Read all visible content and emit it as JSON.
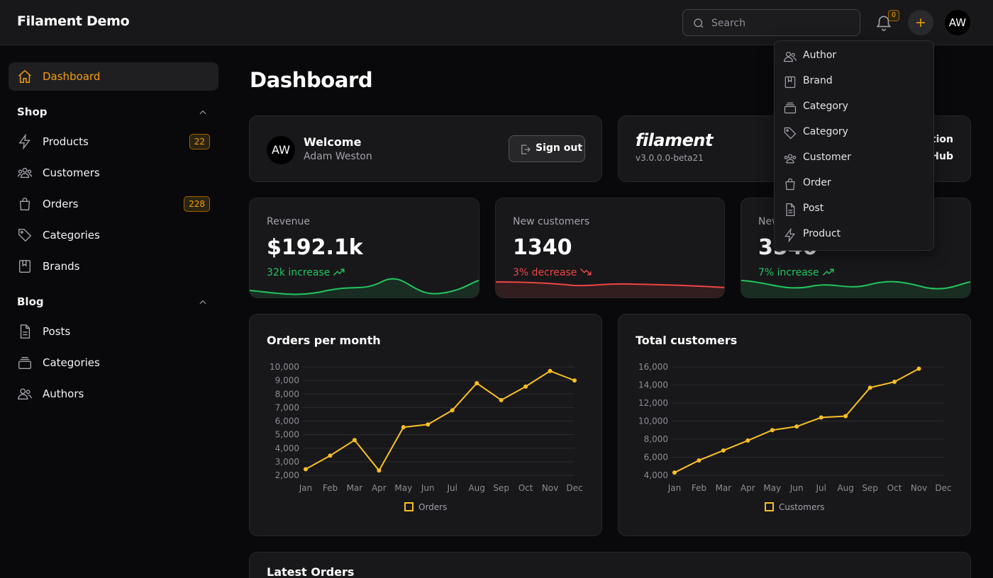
{
  "app": {
    "brand": "Filament Demo"
  },
  "topbar": {
    "search_placeholder": "Search",
    "notifications_count": "0",
    "user_initials": "AW"
  },
  "sidebar": {
    "dashboard": {
      "label": "Dashboard",
      "icon": "home-icon"
    },
    "groups": [
      {
        "title": "Shop",
        "items": [
          {
            "label": "Products",
            "icon": "bolt-icon",
            "badge": "22"
          },
          {
            "label": "Customers",
            "icon": "users-group-icon",
            "badge": ""
          },
          {
            "label": "Orders",
            "icon": "shopping-bag-icon",
            "badge": "228"
          },
          {
            "label": "Categories",
            "icon": "tag-icon",
            "badge": ""
          },
          {
            "label": "Brands",
            "icon": "book-icon",
            "badge": ""
          }
        ]
      },
      {
        "title": "Blog",
        "items": [
          {
            "label": "Posts",
            "icon": "document-icon"
          },
          {
            "label": "Categories",
            "icon": "rectangle-stack-icon"
          },
          {
            "label": "Authors",
            "icon": "users-icon"
          }
        ]
      }
    ]
  },
  "main": {
    "title": "Dashboard",
    "welcome": {
      "initials": "AW",
      "title": "Welcome",
      "name": "Adam Weston",
      "signout_label": "Sign out"
    },
    "filament": {
      "logo": "filament",
      "version": "v3.0.0.0-beta21",
      "link1": "tion",
      "link2": "Hub"
    },
    "stats": [
      {
        "label": "Revenue",
        "value": "$192.1k",
        "description": "32k increase",
        "trend": "up",
        "color": "#22c55e"
      },
      {
        "label": "New customers",
        "value": "1340",
        "description": "3% decrease",
        "trend": "down",
        "color": "#ef4444"
      },
      {
        "label": "New orders",
        "value": "3540",
        "description": "7% increase",
        "trend": "up",
        "color": "#22c55e"
      }
    ],
    "latest_orders_title": "Latest Orders"
  },
  "dropdown": {
    "items": [
      {
        "label": "Author",
        "icon": "users-icon"
      },
      {
        "label": "Brand",
        "icon": "book-icon"
      },
      {
        "label": "Category",
        "icon": "rectangle-stack-icon"
      },
      {
        "label": "Category",
        "icon": "tag-icon"
      },
      {
        "label": "Customer",
        "icon": "users-group-icon"
      },
      {
        "label": "Order",
        "icon": "shopping-bag-icon"
      },
      {
        "label": "Post",
        "icon": "document-icon"
      },
      {
        "label": "Product",
        "icon": "bolt-icon"
      }
    ]
  },
  "chart_data": [
    {
      "type": "line",
      "title": "Orders per month",
      "categories": [
        "Jan",
        "Feb",
        "Mar",
        "Apr",
        "May",
        "Jun",
        "Jul",
        "Aug",
        "Sep",
        "Oct",
        "Nov",
        "Dec"
      ],
      "series": [
        {
          "name": "Orders",
          "values": [
            2450,
            3450,
            4600,
            2350,
            5550,
            5750,
            6800,
            8800,
            7550,
            8550,
            9700,
            9000
          ]
        }
      ],
      "ylim": [
        2000,
        10000
      ],
      "yticks": [
        "2,000",
        "3,000",
        "4,000",
        "5,000",
        "6,000",
        "7,000",
        "8,000",
        "9,000",
        "10,000"
      ],
      "color": "#fbbf24",
      "grid": true,
      "legend": "bottom"
    },
    {
      "type": "line",
      "title": "Total customers",
      "categories": [
        "Jan",
        "Feb",
        "Mar",
        "Apr",
        "May",
        "Jun",
        "Jul",
        "Aug",
        "Sep",
        "Oct",
        "Nov",
        "Dec"
      ],
      "series": [
        {
          "name": "Customers",
          "values": [
            4300,
            5650,
            6750,
            7850,
            9000,
            9400,
            10400,
            10550,
            13700,
            14350,
            15800
          ]
        }
      ],
      "ylim": [
        4000,
        16000
      ],
      "yticks": [
        "4,000",
        "6,000",
        "8,000",
        "10,000",
        "12,000",
        "14,000",
        "16,000"
      ],
      "color": "#fbbf24",
      "grid": true,
      "legend": "bottom"
    }
  ]
}
